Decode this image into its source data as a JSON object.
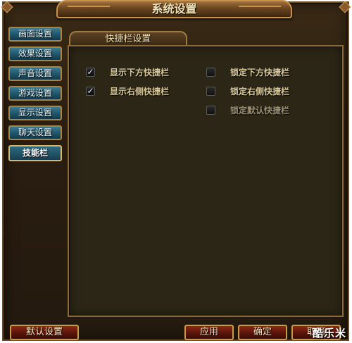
{
  "window": {
    "title": "系统设置",
    "close_symbol": "✕"
  },
  "sidebar": {
    "tabs": [
      {
        "label": "画面设置",
        "active": false
      },
      {
        "label": "效果设置",
        "active": false
      },
      {
        "label": "声音设置",
        "active": false
      },
      {
        "label": "游戏设置",
        "active": false
      },
      {
        "label": "显示设置",
        "active": false
      },
      {
        "label": "聊天设置",
        "active": false
      },
      {
        "label": "技能栏",
        "active": true
      }
    ]
  },
  "panel": {
    "title": "快捷栏设置",
    "options": [
      {
        "label": "显示下方快捷栏",
        "checked": true,
        "disabled": false,
        "mark": "✓"
      },
      {
        "label": "显示右侧快捷栏",
        "checked": true,
        "disabled": false,
        "mark": "✓"
      },
      {
        "label": "锁定下方快捷栏",
        "checked": false,
        "disabled": false,
        "mark": ""
      },
      {
        "label": "锁定右侧快捷栏",
        "checked": false,
        "disabled": false,
        "mark": ""
      },
      {
        "label": "锁定默认快捷栏",
        "checked": false,
        "disabled": true,
        "mark": ""
      }
    ]
  },
  "footer": {
    "default_label": "默认设置",
    "apply_label": "应用",
    "ok_label": "确定",
    "cancel_label": "取消"
  },
  "watermark": "酷乐米"
}
